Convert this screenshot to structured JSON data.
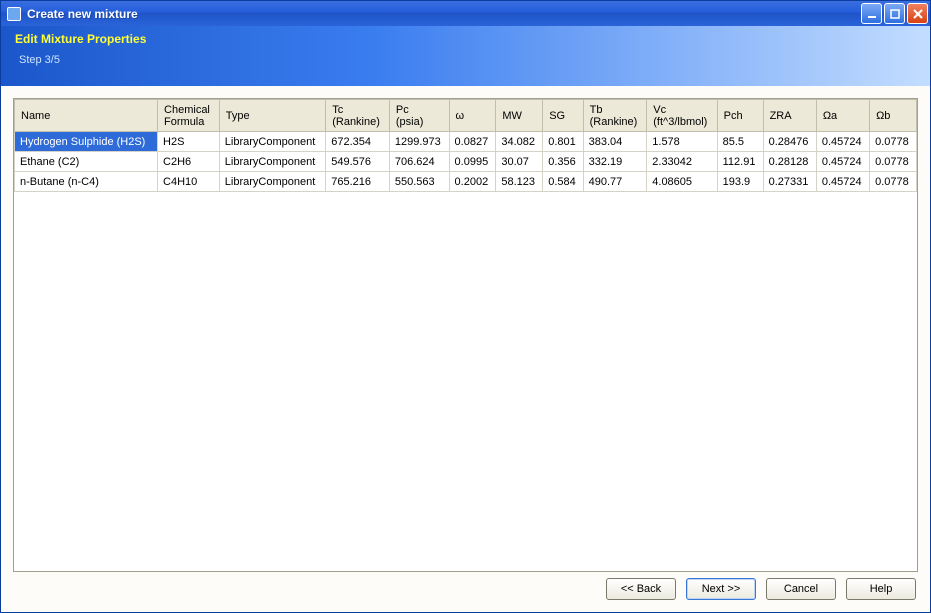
{
  "window": {
    "title": "Create new mixture"
  },
  "banner": {
    "heading": "Edit Mixture Properties",
    "step": "Step 3/5"
  },
  "table": {
    "columns": [
      "Name",
      "Chemical Formula",
      "Type",
      "Tc (Rankine)",
      "Pc (psia)",
      "ω",
      "MW",
      "SG",
      "Tb (Rankine)",
      "Vc (ft^3/lbmol)",
      "Pch",
      "ZRA",
      "Ωa",
      "Ωb"
    ],
    "rows": [
      {
        "selected": true,
        "cells": [
          "Hydrogen Sulphide (H2S)",
          "H2S",
          "LibraryComponent",
          "672.354",
          "1299.973",
          "0.0827",
          "34.082",
          "0.801",
          "383.04",
          "1.578",
          "85.5",
          "0.28476",
          "0.45724",
          "0.0778"
        ]
      },
      {
        "selected": false,
        "cells": [
          "Ethane (C2)",
          "C2H6",
          "LibraryComponent",
          "549.576",
          "706.624",
          "0.0995",
          "30.07",
          "0.356",
          "332.19",
          "2.33042",
          "112.91",
          "0.28128",
          "0.45724",
          "0.0778"
        ]
      },
      {
        "selected": false,
        "cells": [
          "n-Butane (n-C4)",
          "C4H10",
          "LibraryComponent",
          "765.216",
          "550.563",
          "0.2002",
          "58.123",
          "0.584",
          "490.77",
          "4.08605",
          "193.9",
          "0.27331",
          "0.45724",
          "0.0778"
        ]
      }
    ]
  },
  "footer": {
    "back": "<< Back",
    "next": "Next >>",
    "cancel": "Cancel",
    "help": "Help"
  }
}
